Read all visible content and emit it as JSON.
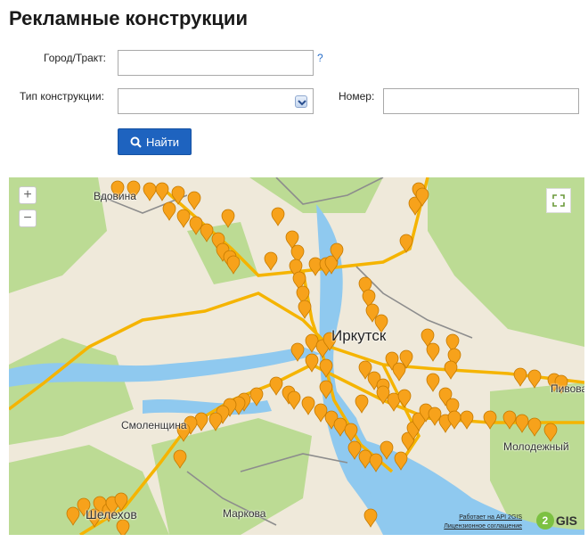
{
  "page": {
    "title": "Рекламные конструкции"
  },
  "form": {
    "city_label": "Город/Тракт:",
    "city_value": "",
    "help": "?",
    "type_label": "Тип конструкции:",
    "type_value": "",
    "number_label": "Номер:",
    "number_value": "",
    "search_label": "Найти"
  },
  "map": {
    "zoom_in": "+",
    "zoom_out": "−",
    "labels": {
      "city": "Иркутск",
      "vdovina": "Вдовина",
      "smolenshina": "Смоленщина",
      "markova": "Маркова",
      "shelekhov": "Шелехов",
      "pivovarikha": "Пивова",
      "molodezhny": "Молодежный"
    },
    "attribution": {
      "powered": "Работает на API 2GIS",
      "license": "Лицензионное соглашение"
    },
    "logo": "2GIS",
    "colors": {
      "marker": "#f7a21b",
      "road": "#f5b400",
      "water": "#8fc9ef",
      "forest": "#b8d98f"
    }
  }
}
